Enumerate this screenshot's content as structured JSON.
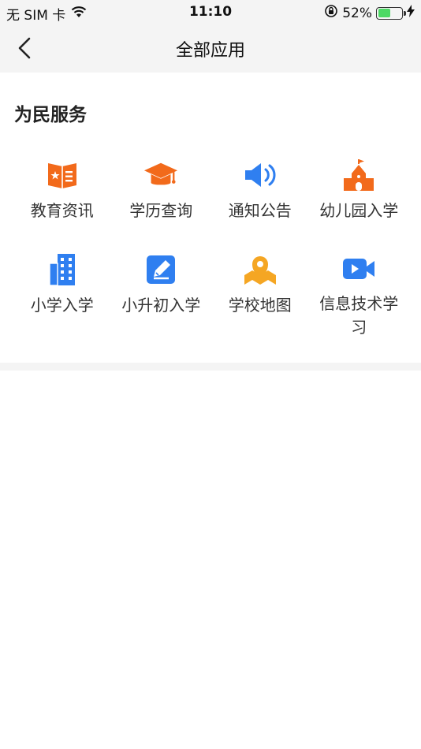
{
  "status_bar": {
    "carrier": "无 SIM 卡",
    "time": "11:10",
    "battery_percent": "52%",
    "battery_level": 0.52
  },
  "nav": {
    "title": "全部应用"
  },
  "section": {
    "title": "为民服务"
  },
  "apps": [
    {
      "label": "教育资讯",
      "icon": "news-icon",
      "color": "#f26a1b"
    },
    {
      "label": "学历查询",
      "icon": "graduation-cap-icon",
      "color": "#f26a1b"
    },
    {
      "label": "通知公告",
      "icon": "speaker-icon",
      "color": "#2f7ff0"
    },
    {
      "label": "幼儿园入学",
      "icon": "kindergarten-icon",
      "color": "#f26a1b"
    },
    {
      "label": "小学入学",
      "icon": "building-icon",
      "color": "#2f7ff0"
    },
    {
      "label": "小升初入学",
      "icon": "edit-icon",
      "color": "#2f7ff0"
    },
    {
      "label": "学校地图",
      "icon": "map-pin-icon",
      "color": "#f5a623"
    },
    {
      "label": "信息技术学习",
      "icon": "video-icon",
      "color": "#2f7ff0"
    }
  ]
}
